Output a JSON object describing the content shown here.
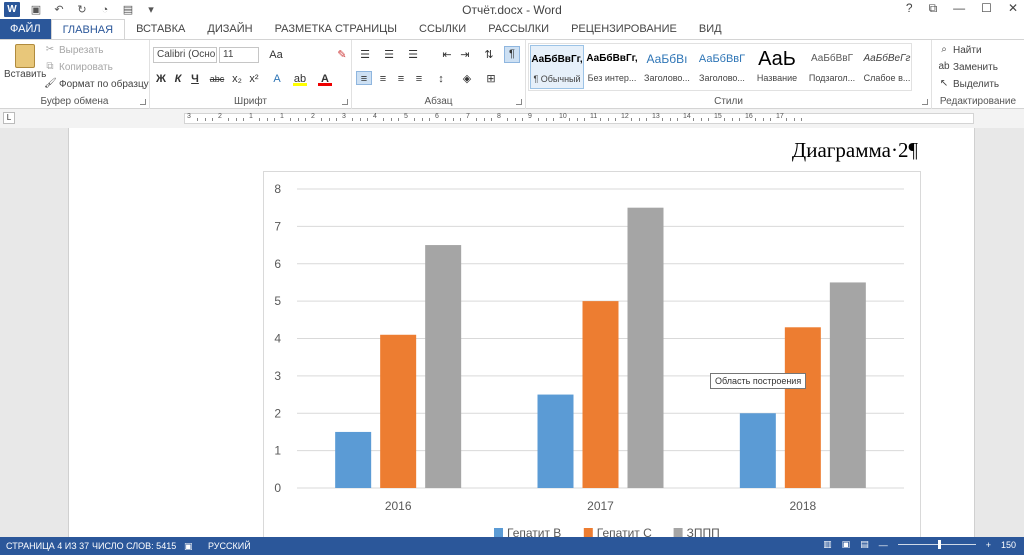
{
  "titlebar": {
    "title": "Отчёт.docx - Word",
    "help": "?",
    "restore": "⧉",
    "minimize": "—",
    "maximize": "☐",
    "close": "✕"
  },
  "tabs": [
    "ФАЙЛ",
    "ГЛАВНАЯ",
    "ВСТАВКА",
    "ДИЗАЙН",
    "РАЗМЕТКА СТРАНИЦЫ",
    "ССЫЛКИ",
    "РАССЫЛКИ",
    "РЕЦЕНЗИРОВАНИЕ",
    "ВИД"
  ],
  "ribbon": {
    "clipboard": {
      "paste": "Вставить",
      "cut": "Вырезать",
      "copy": "Копировать",
      "format_painter": "Формат по образцу",
      "label": "Буфер обмена"
    },
    "font": {
      "name": "Calibri (Осно",
      "size": "11",
      "bold": "Ж",
      "italic": "К",
      "underline": "Ч",
      "strike": "abc",
      "sub": "x₂",
      "sup": "x²",
      "grow": "Aa",
      "label": "Шрифт"
    },
    "paragraph": {
      "label": "Абзац",
      "pilcrow": "¶"
    },
    "styles": {
      "label": "Стили",
      "items": [
        {
          "sample": "АаБбВвГг,",
          "name": "¶ Обычный"
        },
        {
          "sample": "АаБбВвГг,",
          "name": "Без интер..."
        },
        {
          "sample": "АаБбВı",
          "name": "Заголово..."
        },
        {
          "sample": "АаБбВвГ",
          "name": "Заголово..."
        },
        {
          "sample": "АаЬ",
          "name": "Название"
        },
        {
          "sample": "АаБбВвГ",
          "name": "Подзагол..."
        },
        {
          "sample": "АаБбВеГг",
          "name": "Слабое в..."
        }
      ]
    },
    "editing": {
      "find": "Найти",
      "replace": "Заменить",
      "select": "Выделить",
      "label": "Редактирование"
    }
  },
  "ruler": {
    "numbers": [
      "3",
      "2",
      "1",
      "1",
      "2",
      "3",
      "4",
      "5",
      "6",
      "7",
      "8",
      "9",
      "10",
      "11",
      "12",
      "13",
      "14",
      "15",
      "16",
      "17"
    ]
  },
  "document": {
    "heading": "Диаграмма·2¶",
    "tooltip": "Область построения"
  },
  "chart_data": {
    "type": "bar",
    "categories": [
      "2016",
      "2017",
      "2018"
    ],
    "series": [
      {
        "name": "Гепатит В",
        "values": [
          1.5,
          2.5,
          2
        ],
        "color": "#5b9bd5"
      },
      {
        "name": "Гепатит С",
        "values": [
          4.1,
          5,
          4.3
        ],
        "color": "#ed7d31"
      },
      {
        "name": "ЗППП",
        "values": [
          6.5,
          7.5,
          5.5
        ],
        "color": "#a5a5a5"
      }
    ],
    "ylim": [
      0,
      8
    ],
    "yticks": [
      "0",
      "1",
      "2",
      "3",
      "4",
      "5",
      "6",
      "7",
      "8"
    ],
    "grid": true,
    "legend": "bottom"
  },
  "status": {
    "page": "СТРАНИЦА 4 ИЗ 37",
    "words": "ЧИСЛО СЛОВ: 5415",
    "lang": "РУССКИЙ",
    "zoom": "150"
  }
}
